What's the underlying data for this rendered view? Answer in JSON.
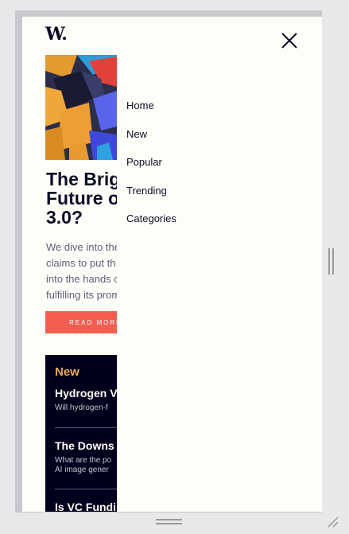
{
  "logo": {
    "text": "W."
  },
  "hero": {
    "headline": "The Brig\nFuture o\n3.0?",
    "teaser": "We dive into the\nclaims to put th\ninto the hands o\nfulfilling its prom",
    "read_more_label": "READ MORE"
  },
  "new_panel": {
    "heading": "New",
    "items": [
      {
        "title": "Hydrogen V",
        "desc": "Will hydrogen-f"
      },
      {
        "title": "The Downs",
        "desc": "What are the po\nAI image gener"
      },
      {
        "title": "Is VC Fundi",
        "desc": ""
      }
    ]
  },
  "menu": {
    "items": [
      "Home",
      "New",
      "Popular",
      "Trending",
      "Categories"
    ]
  },
  "colors": {
    "background": "#fffdf8",
    "navy": "#00001d",
    "accent": "#f15e50",
    "heading_orange": "#e9ab53",
    "text_dark": "#0b0d26"
  },
  "icons": {
    "close": "close-icon",
    "resize_grip": "resize-grip-icon"
  }
}
